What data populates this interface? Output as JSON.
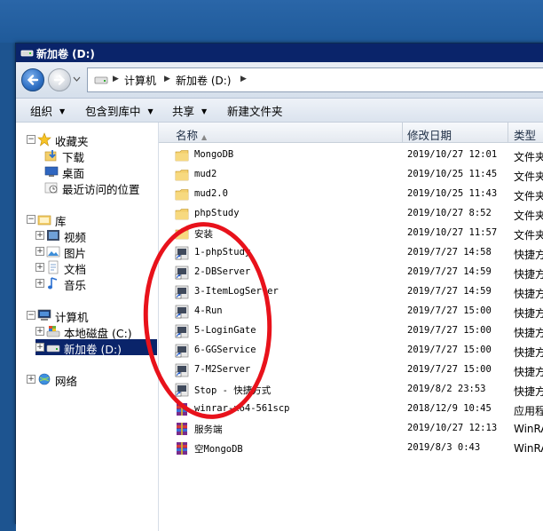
{
  "window": {
    "title": "新加卷 (D:)"
  },
  "address": {
    "crumbs": [
      "计算机",
      "新加卷 (D:)"
    ]
  },
  "toolbar": {
    "organize": "组织",
    "include": "包含到库中",
    "share": "共享",
    "new_folder": "新建文件夹"
  },
  "nav": {
    "favorites": "收藏夹",
    "downloads": "下载",
    "desktop": "桌面",
    "recent": "最近访问的位置",
    "libraries": "库",
    "videos": "视频",
    "pictures": "图片",
    "documents": "文档",
    "music": "音乐",
    "computer": "计算机",
    "local_c": "本地磁盘 (C:)",
    "new_d": "新加卷 (D:)",
    "network": "网络"
  },
  "columns": {
    "name": "名称",
    "date": "修改日期",
    "type": "类型"
  },
  "files": [
    {
      "name": "MongoDB",
      "date": "2019/10/27 12:01",
      "type": "文件夹",
      "icon": "folder-icon"
    },
    {
      "name": "mud2",
      "date": "2019/10/25 11:45",
      "type": "文件夹",
      "icon": "folder-icon"
    },
    {
      "name": "mud2.0",
      "date": "2019/10/25 11:43",
      "type": "文件夹",
      "icon": "folder-icon"
    },
    {
      "name": "phpStudy",
      "date": "2019/10/27 8:52",
      "type": "文件夹",
      "icon": "folder-icon"
    },
    {
      "name": "安装",
      "date": "2019/10/27 11:57",
      "type": "文件夹",
      "icon": "folder-icon"
    },
    {
      "name": "1-phpStudy",
      "date": "2019/7/27 14:58",
      "type": "快捷方式",
      "icon": "shortcut-icon"
    },
    {
      "name": "2-DBServer",
      "date": "2019/7/27 14:59",
      "type": "快捷方式",
      "icon": "shortcut-icon"
    },
    {
      "name": "3-ItemLogServer",
      "date": "2019/7/27 14:59",
      "type": "快捷方式",
      "icon": "shortcut-icon"
    },
    {
      "name": "4-Run",
      "date": "2019/7/27 15:00",
      "type": "快捷方式",
      "icon": "shortcut-icon"
    },
    {
      "name": "5-LoginGate",
      "date": "2019/7/27 15:00",
      "type": "快捷方式",
      "icon": "shortcut-icon"
    },
    {
      "name": "6-GGService",
      "date": "2019/7/27 15:00",
      "type": "快捷方式",
      "icon": "shortcut-icon"
    },
    {
      "name": "7-M2Server",
      "date": "2019/7/27 15:00",
      "type": "快捷方式",
      "icon": "shortcut-icon"
    },
    {
      "name": "Stop - 快捷方式",
      "date": "2019/8/2 23:53",
      "type": "快捷方式",
      "icon": "shortcut-icon"
    },
    {
      "name": "winrar-x64-561scp",
      "date": "2018/12/9 10:45",
      "type": "应用程序",
      "icon": "winrar-icon"
    },
    {
      "name": "服务端",
      "date": "2019/10/27 12:13",
      "type": "WinRAR",
      "icon": "winrar-icon"
    },
    {
      "name": "空MongoDB",
      "date": "2019/8/3 0:43",
      "type": "WinRAR",
      "icon": "winrar-icon"
    }
  ],
  "colors": {
    "annotation": "#e8121b",
    "selection": "#0a246a"
  }
}
